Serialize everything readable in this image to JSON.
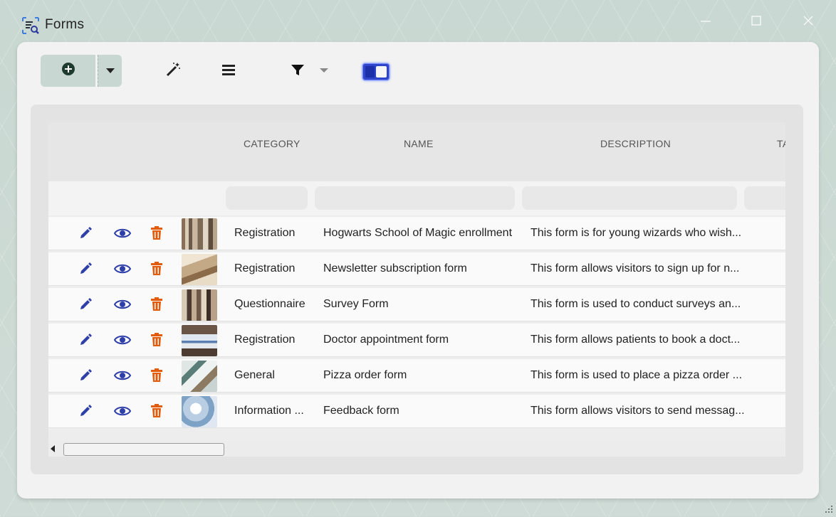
{
  "window": {
    "title": "Forms",
    "icon": "forms-search-icon",
    "controls": [
      "minimize-icon",
      "maximize-icon",
      "close-icon"
    ]
  },
  "toolbar": {
    "add_icon": "plus-circle-icon",
    "dropdown_icon": "chevron-down-icon",
    "wand_icon": "magic-wand-icon",
    "menu_icon": "hamburger-menu-icon",
    "filter_icon": "filter-icon",
    "toggle_icon": "toggle-icon"
  },
  "table": {
    "columns": [
      "CATEGORY",
      "NAME",
      "DESCRIPTION",
      "TA"
    ],
    "rows": [
      {
        "category": "Registration",
        "name": "Hogwarts School of Magic enrollment",
        "description": "This form is for young wizards who wish..."
      },
      {
        "category": "Registration",
        "name": "Newsletter subscription form",
        "description": "This form allows visitors to sign up for n..."
      },
      {
        "category": "Questionnaire",
        "name": "Survey Form",
        "description": "This form is used to conduct surveys an..."
      },
      {
        "category": "Registration",
        "name": "Doctor appointment form",
        "description": "This form allows patients to book a doct..."
      },
      {
        "category": "General",
        "name": "Pizza order form",
        "description": "This form is used to place a pizza order ..."
      },
      {
        "category": "Information ...",
        "name": "Feedback form",
        "description": "This form allows visitors to send messag..."
      }
    ]
  },
  "colors": {
    "accent": "#2f3fa8",
    "delete": "#e35b0d",
    "toggle": "#2f45c9"
  }
}
